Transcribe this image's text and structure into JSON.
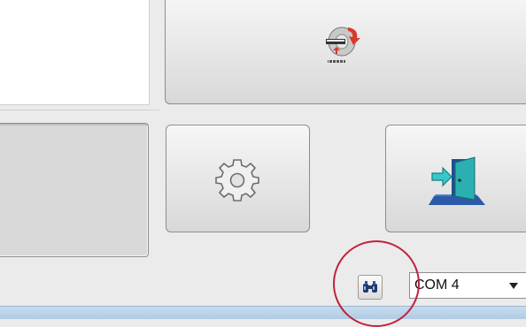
{
  "buttons": {
    "restore_icon": "disk-restore-icon",
    "settings_icon": "gear-icon",
    "exit_icon": "exit-door-icon"
  },
  "toolbar": {
    "find_icon": "binoculars-icon",
    "com_port": {
      "selected": "COM 4"
    }
  },
  "colors": {
    "highlight_circle": "#c0223b",
    "bottom_strip": "#b8d0e6"
  }
}
